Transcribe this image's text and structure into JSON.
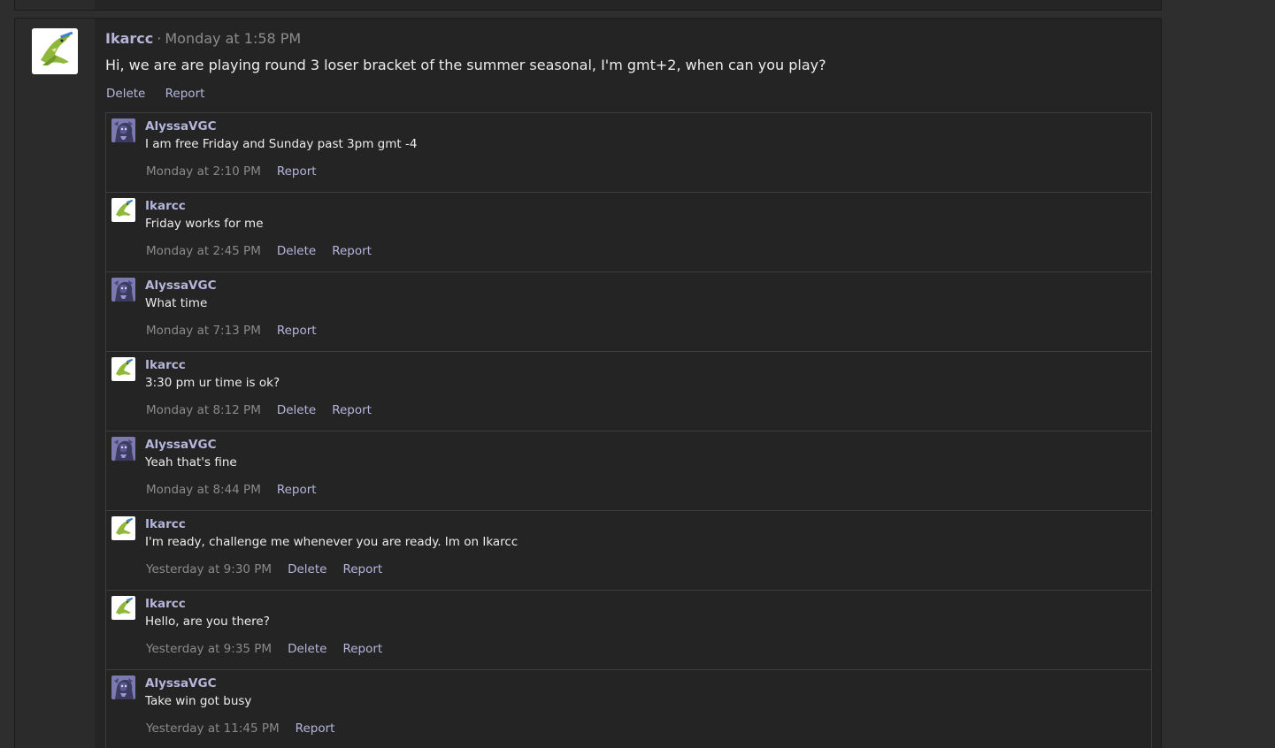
{
  "colors": {
    "page_background": "#2e2e2e",
    "block_background": "#242424",
    "sidebar_background": "#2b2b2b",
    "author_link": "#b5b6dc",
    "timestamp": "#8a8a8a",
    "body_text": "#ececec"
  },
  "main_message": {
    "author": "Ikarcc",
    "separator": "·",
    "timestamp": "Monday at 1:58 PM",
    "text": "Hi, we are are playing round 3 loser bracket of the summer seasonal, I'm gmt+2, when can you play?",
    "actions": {
      "delete_label": "Delete",
      "report_label": "Report"
    },
    "avatar_icon": "crocodile-avatar-icon"
  },
  "replies": [
    {
      "author": "AlyssaVGC",
      "text": "I am free Friday and Sunday past 3pm gmt -4",
      "time": "Monday at 2:10 PM",
      "report": "Report"
    },
    {
      "author": "Ikarcc",
      "text": "Friday works for me",
      "time": "Monday at 2:45 PM",
      "delete": "Delete",
      "report": "Report"
    },
    {
      "author": "AlyssaVGC",
      "text": "What time",
      "time": "Monday at 7:13 PM",
      "report": "Report"
    },
    {
      "author": "Ikarcc",
      "text": "3:30 pm ur time is ok?",
      "time": "Monday at 8:12 PM",
      "delete": "Delete",
      "report": "Report"
    },
    {
      "author": "AlyssaVGC",
      "text": "Yeah that's fine",
      "time": "Monday at 8:44 PM",
      "report": "Report"
    },
    {
      "author": "Ikarcc",
      "text": "I'm ready, challenge me whenever you are ready. Im on Ikarcc",
      "time": "Yesterday at 9:30 PM",
      "delete": "Delete",
      "report": "Report"
    },
    {
      "author": "Ikarcc",
      "text": "Hello, are you there?",
      "time": "Yesterday at 9:35 PM",
      "delete": "Delete",
      "report": "Report"
    },
    {
      "author": "AlyssaVGC",
      "text": "Take win got busy",
      "time": "Yesterday at 11:45 PM",
      "report": "Report"
    }
  ]
}
